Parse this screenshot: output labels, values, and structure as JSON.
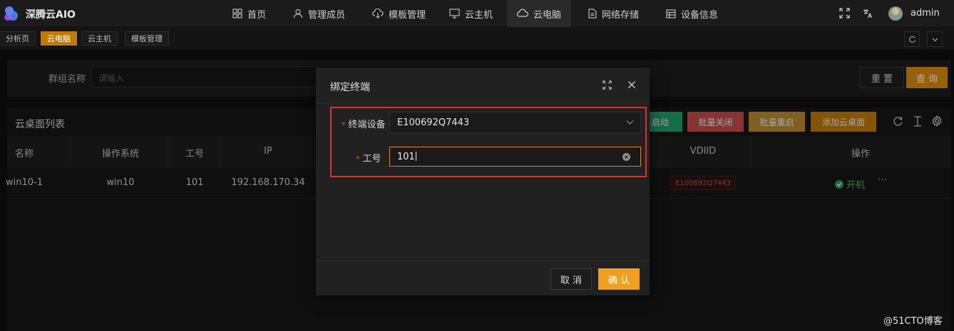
{
  "app": {
    "brand": "深腾云AIO"
  },
  "nav": [
    {
      "label": "首页",
      "icon": "dashboard-icon"
    },
    {
      "label": "管理成员",
      "icon": "user-icon"
    },
    {
      "label": "模板管理",
      "icon": "cloud-download-icon"
    },
    {
      "label": "云主机",
      "icon": "monitor-icon"
    },
    {
      "label": "云电脑",
      "icon": "cloud-icon",
      "active": true
    },
    {
      "label": "网络存储",
      "icon": "file-icon"
    },
    {
      "label": "设备信息",
      "icon": "table-icon"
    }
  ],
  "user": {
    "name": "admin"
  },
  "tabs": [
    {
      "label": "分析页"
    },
    {
      "label": "云电脑",
      "active": true
    },
    {
      "label": "云主机"
    },
    {
      "label": "模板管理"
    }
  ],
  "search": {
    "label": "群组名称",
    "placeholder": "请输入",
    "reset": "重 置",
    "query": "查 询"
  },
  "list": {
    "title": "云桌面列表",
    "actions": {
      "batch_start": "批量启动",
      "batch_start_visible": "启动",
      "batch_close": "批量关闭",
      "batch_restart": "批量重启",
      "add": "添加云桌面"
    },
    "columns": [
      "名称",
      "操作系统",
      "工号",
      "IP",
      "VDIID",
      "操作"
    ],
    "rows": [
      {
        "name": "win10-1",
        "os": "win10",
        "emp_no": "101",
        "ip": "192.168.170.34",
        "vdiid": "E100692Q7443",
        "action": "开机",
        "more": "···"
      }
    ]
  },
  "modal": {
    "title": "绑定终端",
    "device_label": "终端设备",
    "device_value": "E100692Q7443",
    "emp_label": "工号",
    "emp_value": "101",
    "cancel": "取 消",
    "confirm": "确 认"
  },
  "colors": {
    "accent": "#d88a10",
    "confirm": "#f0a020",
    "danger": "#e0302a",
    "success_btn": "#1f9e6a",
    "close_btn": "#c14b4b",
    "restart_btn": "#b88a2e",
    "add_btn": "#c0790d"
  },
  "watermark": "@51CTO博客"
}
